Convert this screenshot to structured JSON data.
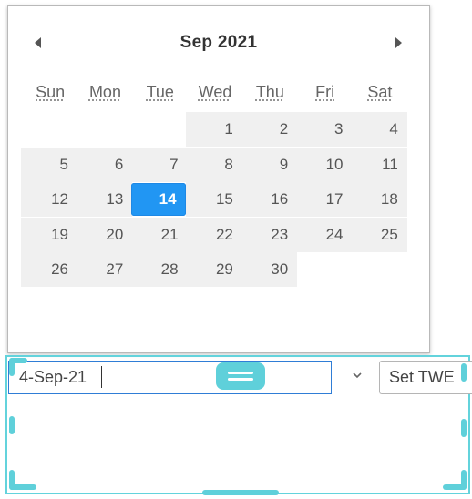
{
  "calendar": {
    "month_title": "Sep 2021",
    "prev_icon": "triangle-left",
    "next_icon": "triangle-right",
    "weekdays": [
      "Sun",
      "Mon",
      "Tue",
      "Wed",
      "Thu",
      "Fri",
      "Sat"
    ],
    "weeks": [
      [
        "",
        "",
        "",
        "1",
        "2",
        "3",
        "4"
      ],
      [
        "5",
        "6",
        "7",
        "8",
        "9",
        "10",
        "11"
      ],
      [
        "12",
        "13",
        "14",
        "15",
        "16",
        "17",
        "18"
      ],
      [
        "19",
        "20",
        "21",
        "22",
        "23",
        "24",
        "25"
      ],
      [
        "26",
        "27",
        "28",
        "29",
        "30",
        "",
        ""
      ]
    ],
    "selected_day": "14",
    "selected_color": "#2196f3"
  },
  "editor": {
    "date_value": "4-Sep-21",
    "dropdown_icon": "chevron-down",
    "set_button_label": "Set TWE",
    "accent_color": "#5fd0da"
  }
}
